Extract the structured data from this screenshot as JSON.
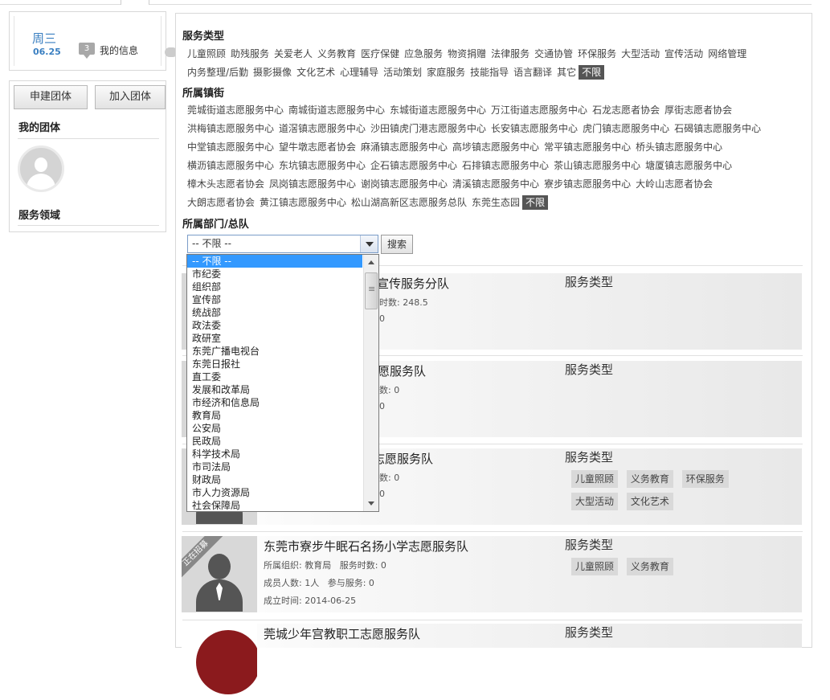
{
  "sidebar": {
    "weekday": "周三",
    "date": "06.25",
    "msg_count": "3",
    "my_messages": "我的信息",
    "create_group": "申建团体",
    "join_group": "加入团体",
    "my_groups": "我的团体",
    "service_fields": "服务领域"
  },
  "filters": {
    "service_type_title": "服务类型",
    "service_types_row1": [
      "儿童照顾",
      "助残服务",
      "关爱老人",
      "义务教育",
      "医疗保健",
      "应急服务",
      "物资捐赠",
      "法律服务",
      "交通协管",
      "环保服务",
      "大型活动",
      "宣传活动",
      "网络管理"
    ],
    "service_types_row2": [
      "内务整理/后勤",
      "摄影摄像",
      "文化艺术",
      "心理辅导",
      "活动策划",
      "家庭服务",
      "技能指导",
      "语言翻译",
      "其它"
    ],
    "unlimited": "不限",
    "town_title": "所属镇街",
    "towns_rows": [
      [
        "莞城街道志愿服务中心",
        "南城街道志愿服务中心",
        "东城街道志愿服务中心",
        "万江街道志愿服务中心",
        "石龙志愿者协会",
        "厚街志愿者协会"
      ],
      [
        "洪梅镇志愿服务中心",
        "道滘镇志愿服务中心",
        "沙田镇虎门港志愿服务中心",
        "长安镇志愿服务中心",
        "虎门镇志愿服务中心",
        "石碣镇志愿服务中心"
      ],
      [
        "中堂镇志愿服务中心",
        "望牛墩志愿者协会",
        "麻涌镇志愿服务中心",
        "高埗镇志愿服务中心",
        "常平镇志愿服务中心",
        "桥头镇志愿服务中心"
      ],
      [
        "横沥镇志愿服务中心",
        "东坑镇志愿服务中心",
        "企石镇志愿服务中心",
        "石排镇志愿服务中心",
        "茶山镇志愿服务中心",
        "塘厦镇志愿服务中心"
      ],
      [
        "樟木头志愿者协会",
        "凤岗镇志愿服务中心",
        "谢岗镇志愿服务中心",
        "清溪镇志愿服务中心",
        "寮步镇志愿服务中心",
        "大岭山志愿者协会"
      ],
      [
        "大朗志愿者协会",
        "黄江镇志愿服务中心",
        "松山湖高新区志愿服务总队",
        "东莞生态园"
      ]
    ],
    "dept_title": "所属部门/总队",
    "dept_selected": "-- 不限 --",
    "search_label": "搜索",
    "dept_options": [
      "-- 不限 --",
      "市纪委",
      "组织部",
      "宣传部",
      "统战部",
      "政法委",
      "政研室",
      "东莞广播电视台",
      "东莞日报社",
      "直工委",
      "发展和改革局",
      "市经济和信息局",
      "教育局",
      "公安局",
      "民政局",
      "科学技术局",
      "市司法局",
      "财政局",
      "市人力资源局",
      "社会保障局"
    ]
  },
  "cards": [
    {
      "name_visible": "币宣传服务分队",
      "line1_visible": "时数: 248.5",
      "line2_visible": "0",
      "svc_label": "服务类型",
      "tags": []
    },
    {
      "name_visible": "愿服务队",
      "line1_visible": "数: 0",
      "line2_visible": "0",
      "svc_label": "服务类型",
      "tags": []
    },
    {
      "name_visible": "志愿服务队",
      "line1_visible": "数: 0",
      "line2_visible": "0",
      "svc_label": "服务类型",
      "tags": [
        "儿童照顾",
        "义务教育",
        "环保服务",
        "大型活动",
        "文化艺术"
      ]
    },
    {
      "name": "东莞市寮步牛眠石名扬小学志愿服务队",
      "org": "所属组织: 教育局",
      "hours": "服务时数: 0",
      "members": "成员人数: 1人",
      "served": "参与服务: 0",
      "founded": "成立时间: 2014-06-25",
      "ribbon": "正在招募",
      "svc_label": "服务类型",
      "tags": [
        "儿童照顾",
        "义务教育"
      ]
    },
    {
      "name": "莞城少年宫教职工志愿服务队",
      "svc_label": "服务类型"
    }
  ]
}
